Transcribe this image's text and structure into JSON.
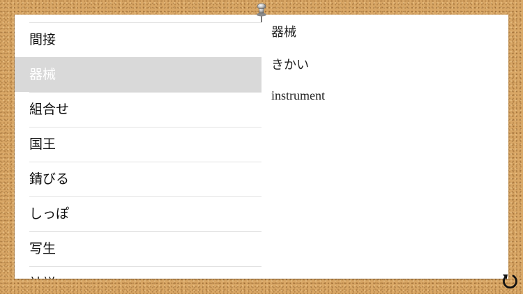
{
  "word_list": [
    {
      "word": "間接"
    },
    {
      "word": "器械",
      "selected": true
    },
    {
      "word": "組合せ"
    },
    {
      "word": "国王"
    },
    {
      "word": "錆びる"
    },
    {
      "word": "しっぽ"
    },
    {
      "word": "写生"
    },
    {
      "word": "社説"
    }
  ],
  "detail": {
    "word": "器械",
    "reading": "きかい",
    "meaning": "instrument"
  },
  "icons": {
    "pin": "pushpin-icon",
    "refresh": "refresh-icon"
  },
  "colors": {
    "cork": "#d9a766",
    "selected_row": "#d9d9d9"
  }
}
